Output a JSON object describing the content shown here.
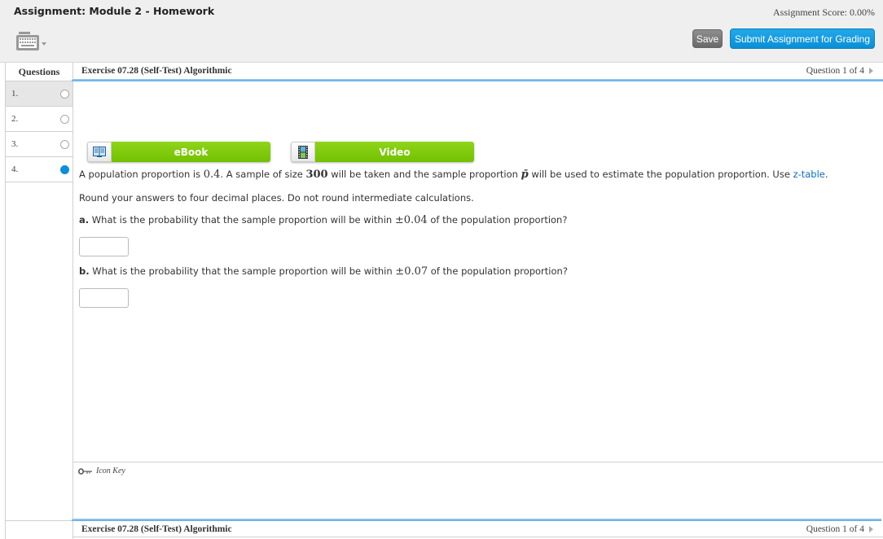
{
  "header": {
    "title": "Assignment: Module 2 - Homework",
    "score": "Assignment Score: 0.00%",
    "save_label": "Save",
    "submit_label": "Submit Assignment for Grading",
    "keyboard_icon": "keyboard-icon"
  },
  "sidebar": {
    "heading": "Questions",
    "items": [
      {
        "label": "1.",
        "status": "unanswered",
        "active": true
      },
      {
        "label": "2.",
        "status": "unanswered",
        "active": false
      },
      {
        "label": "3.",
        "status": "unanswered",
        "active": false
      },
      {
        "label": "4.",
        "status": "answered",
        "active": false
      }
    ]
  },
  "exercise": {
    "title": "Exercise 07.28 (Self-Test) Algorithmic",
    "position": "Question 1 of 4",
    "footer_title": "Exercise 07.28 (Self-Test) Algorithmic",
    "footer_position": "Question 1 of 4"
  },
  "resources": {
    "ebook_label": "eBook",
    "video_label": "Video"
  },
  "question": {
    "intro_1": "A population proportion is ",
    "p_value": "0.4",
    "intro_2": ". A sample of size ",
    "n_value": "300",
    "intro_3": " will be taken and the sample proportion ",
    "pbar": "p̄",
    "intro_4": " will be used to estimate the population proportion. Use ",
    "ztable_link": "z-table",
    "intro_5": ".",
    "instructions": "Round your answers to four decimal places. Do not round intermediate calculations.",
    "part_a_label": "a.",
    "part_a_text_1": " What is the probability that the sample proportion will be within ",
    "part_a_value": "±0.04",
    "part_a_text_2": " of the population proportion?",
    "part_a_answer": "",
    "part_b_label": "b.",
    "part_b_text_1": " What is the probability that the sample proportion will be within ",
    "part_b_value": "±0.07",
    "part_b_text_2": " of the population proportion?",
    "part_b_answer": ""
  },
  "icon_key": {
    "label": "Icon Key"
  },
  "colors": {
    "accent_blue": "#0b8fdc",
    "resource_green": "#7cc70a",
    "save_gray": "#7a7a7a"
  }
}
